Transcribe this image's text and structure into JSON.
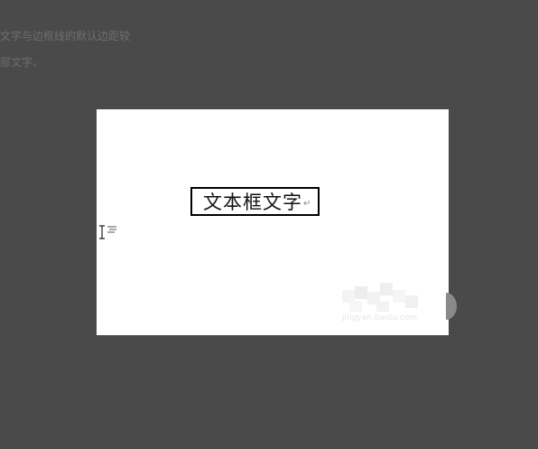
{
  "background_text": {
    "line_1": "文字与边框线的默认边距较",
    "line_2": "部文字。"
  },
  "viewer": {
    "textbox_text": "文本框文字",
    "return_mark": "↵",
    "cursor_icon": "text-cursor-icon",
    "paragraph_icon": "paragraph-align-icon",
    "watermark_text": "jingyan.baidu.com",
    "next_icon": "next-arrow-icon"
  },
  "colors": {
    "overlay": "#4a4a4a",
    "viewer_bg": "#ffffff",
    "textbox_border": "#000000"
  }
}
